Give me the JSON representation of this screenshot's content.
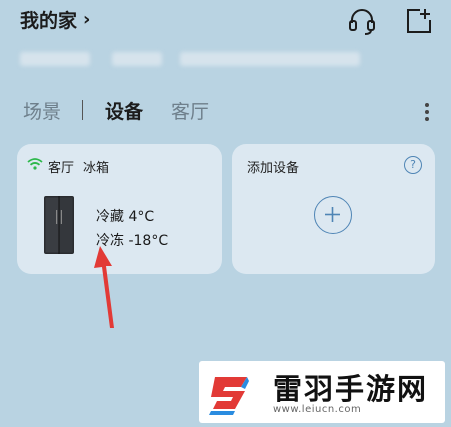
{
  "header": {
    "home_title": "我的家",
    "chevron": "›",
    "support_icon": "headset-icon",
    "add_icon": "add-device-icon"
  },
  "tabs": [
    {
      "label": "场景",
      "active": false
    },
    {
      "label": "设备",
      "active": true
    },
    {
      "label": "客厅",
      "active": false
    }
  ],
  "devices": {
    "fridge": {
      "room": "客厅",
      "name": "冰箱",
      "fridge_temp": "冷藏 4°C",
      "freezer_temp": "冷冻 -18°C",
      "status_icon": "wifi-icon"
    },
    "add_card": {
      "title": "添加设备",
      "help": "?",
      "icon": "plus-circle-icon"
    }
  },
  "watermark": {
    "name": "雷羽手游网",
    "url": "www.leiucn.com"
  },
  "colors": {
    "background": "#b9d3e2",
    "card": "#dce8f1",
    "accent": "#4f85b5",
    "arrow": "#e23a36"
  }
}
